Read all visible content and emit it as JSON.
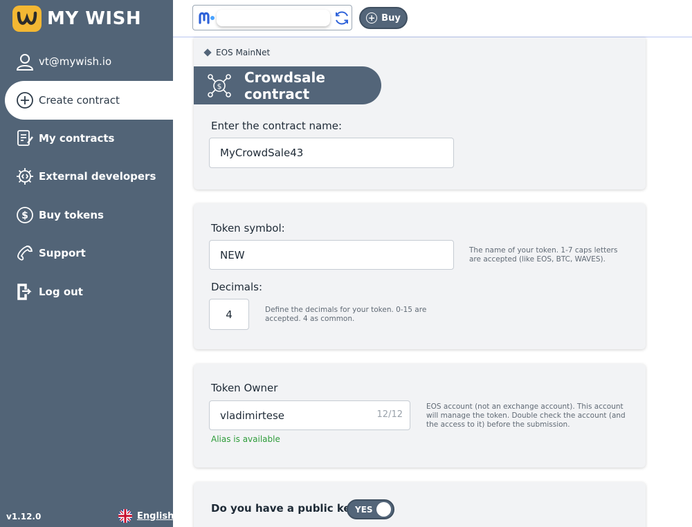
{
  "brand": {
    "name": "MY WISH"
  },
  "sidebar": {
    "user": "vt@mywish.io",
    "items": [
      {
        "label": "Create contract",
        "icon": "plus-circle-icon"
      },
      {
        "label": "My contracts",
        "icon": "contracts-icon"
      },
      {
        "label": "External developers",
        "icon": "gear-code-icon"
      },
      {
        "label": "Buy tokens",
        "icon": "dollar-circle-icon"
      },
      {
        "label": "Support",
        "icon": "phone-icon"
      },
      {
        "label": "Log out",
        "icon": "logout-icon"
      }
    ],
    "version": "v1.12.0",
    "language": "English"
  },
  "topbar": {
    "buy_label": "Buy"
  },
  "contract": {
    "network": "EOS MainNet",
    "title": "Crowdsale contract",
    "name_label": "Enter the contract name:",
    "name_value": "MyCrowdSale43"
  },
  "token": {
    "symbol_label": "Token symbol:",
    "symbol_value": "NEW",
    "symbol_hint": "The name of your token. 1-7 caps letters are accepted (like EOS, BTC, WAVES).",
    "decimals_label": "Decimals:",
    "decimals_value": "4",
    "decimals_hint": "Define the decimals for your token. 0-15 are accepted. 4 as common."
  },
  "owner": {
    "label": "Token Owner",
    "value": "vladimirtese",
    "counter": "12/12",
    "available": "Alias is available",
    "hint": "EOS account (not an exchange account). This account will manage the token. Double check the account (and the access to it) before the submission."
  },
  "public_key": {
    "label": "Do you have a public key?",
    "toggle": "YES"
  },
  "colors": {
    "sidebar": "#526477",
    "accent": "#536579",
    "logo": "#f3b733",
    "success": "#2e9c3a"
  }
}
